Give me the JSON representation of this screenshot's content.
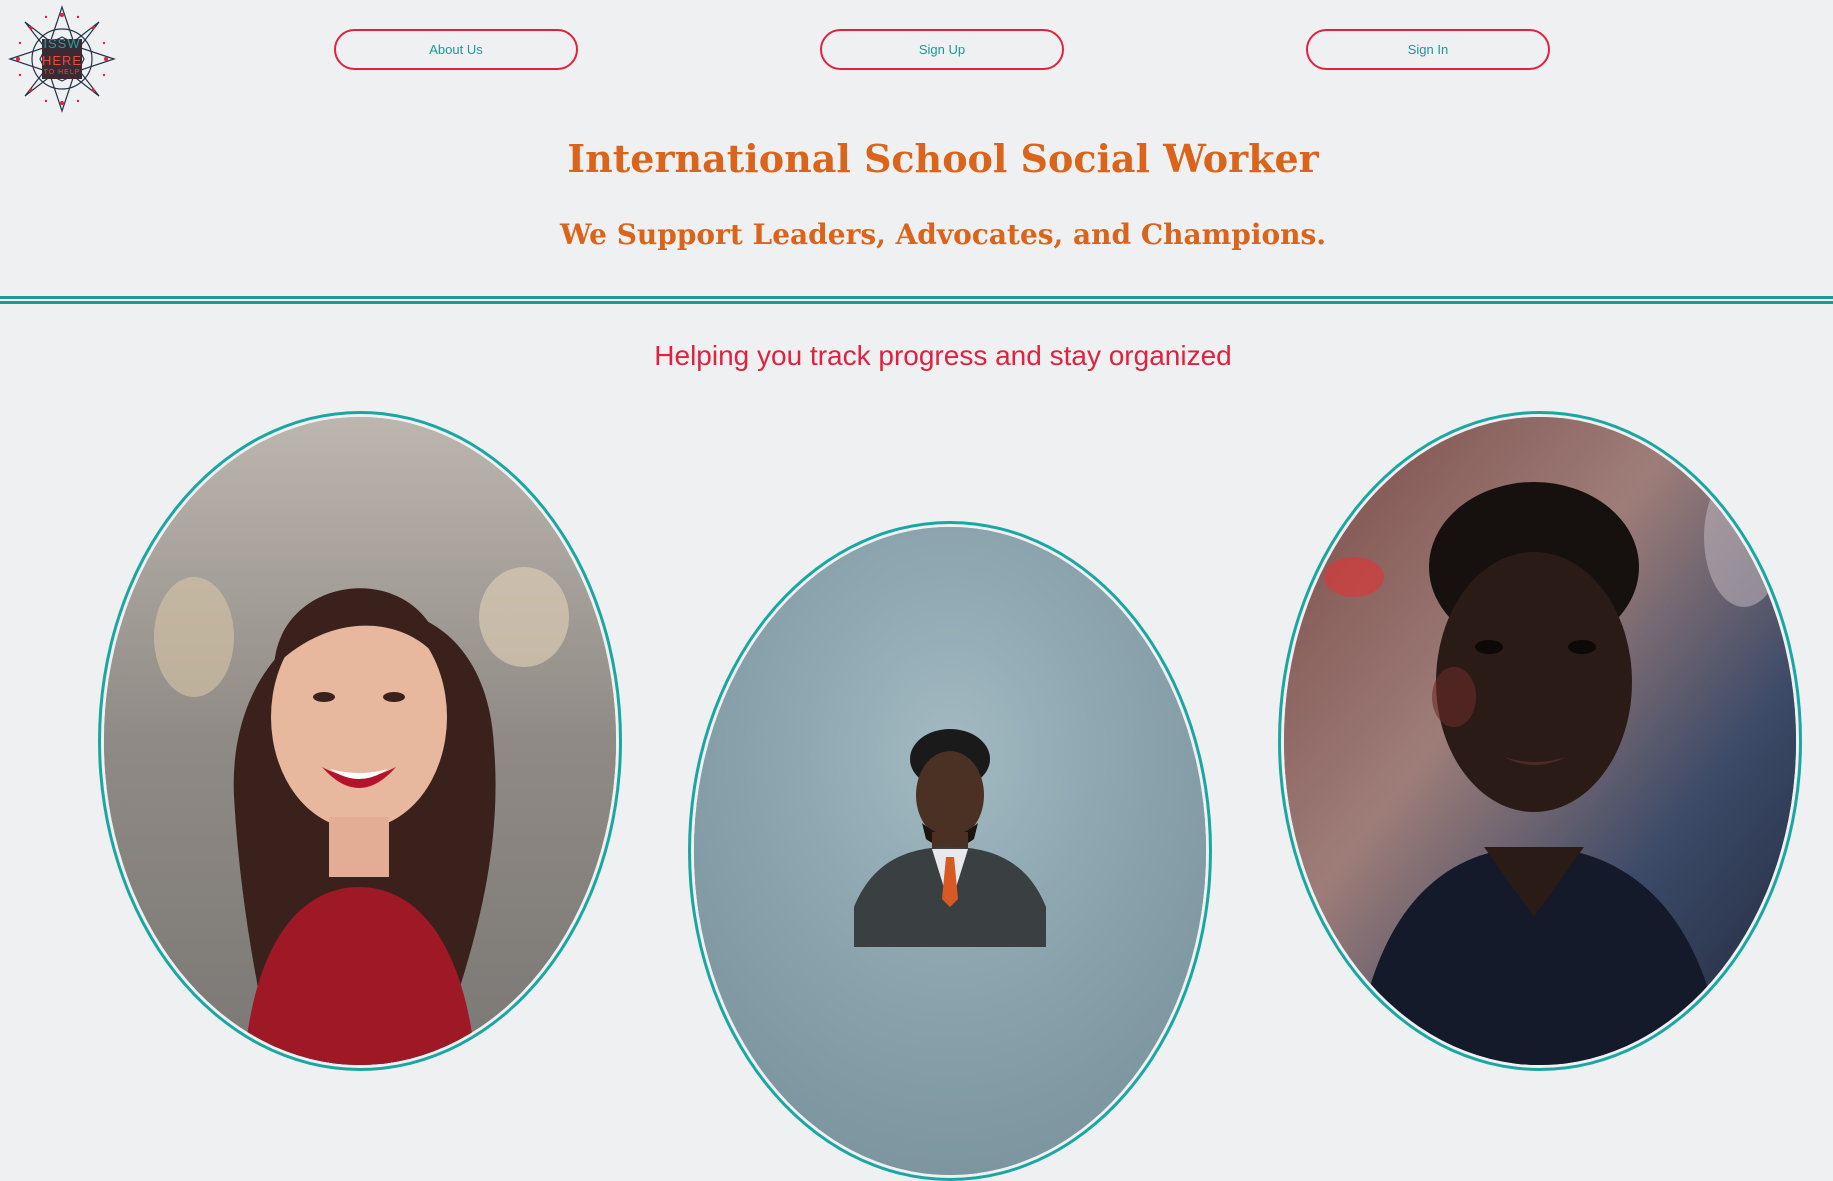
{
  "logo": {
    "line1": "ISSW",
    "line2": "HERE",
    "line3": "TO HELP"
  },
  "nav": {
    "about": "About Us",
    "signup": "Sign Up",
    "signin": "Sign In"
  },
  "hero": {
    "title": "International School Social Worker",
    "subtitle": "We Support Leaders, Advocates, and Champions."
  },
  "tagline": "Helping you track progress and stay organized",
  "photos": [
    {
      "subject": "smiling woman with red top"
    },
    {
      "subject": "man in vest and tie"
    },
    {
      "subject": "boy in dark jacket"
    }
  ],
  "colors": {
    "accent_orange": "#d9641a",
    "accent_red": "#e0213f",
    "accent_teal": "#1a9a94",
    "background": "#eff0f2"
  }
}
